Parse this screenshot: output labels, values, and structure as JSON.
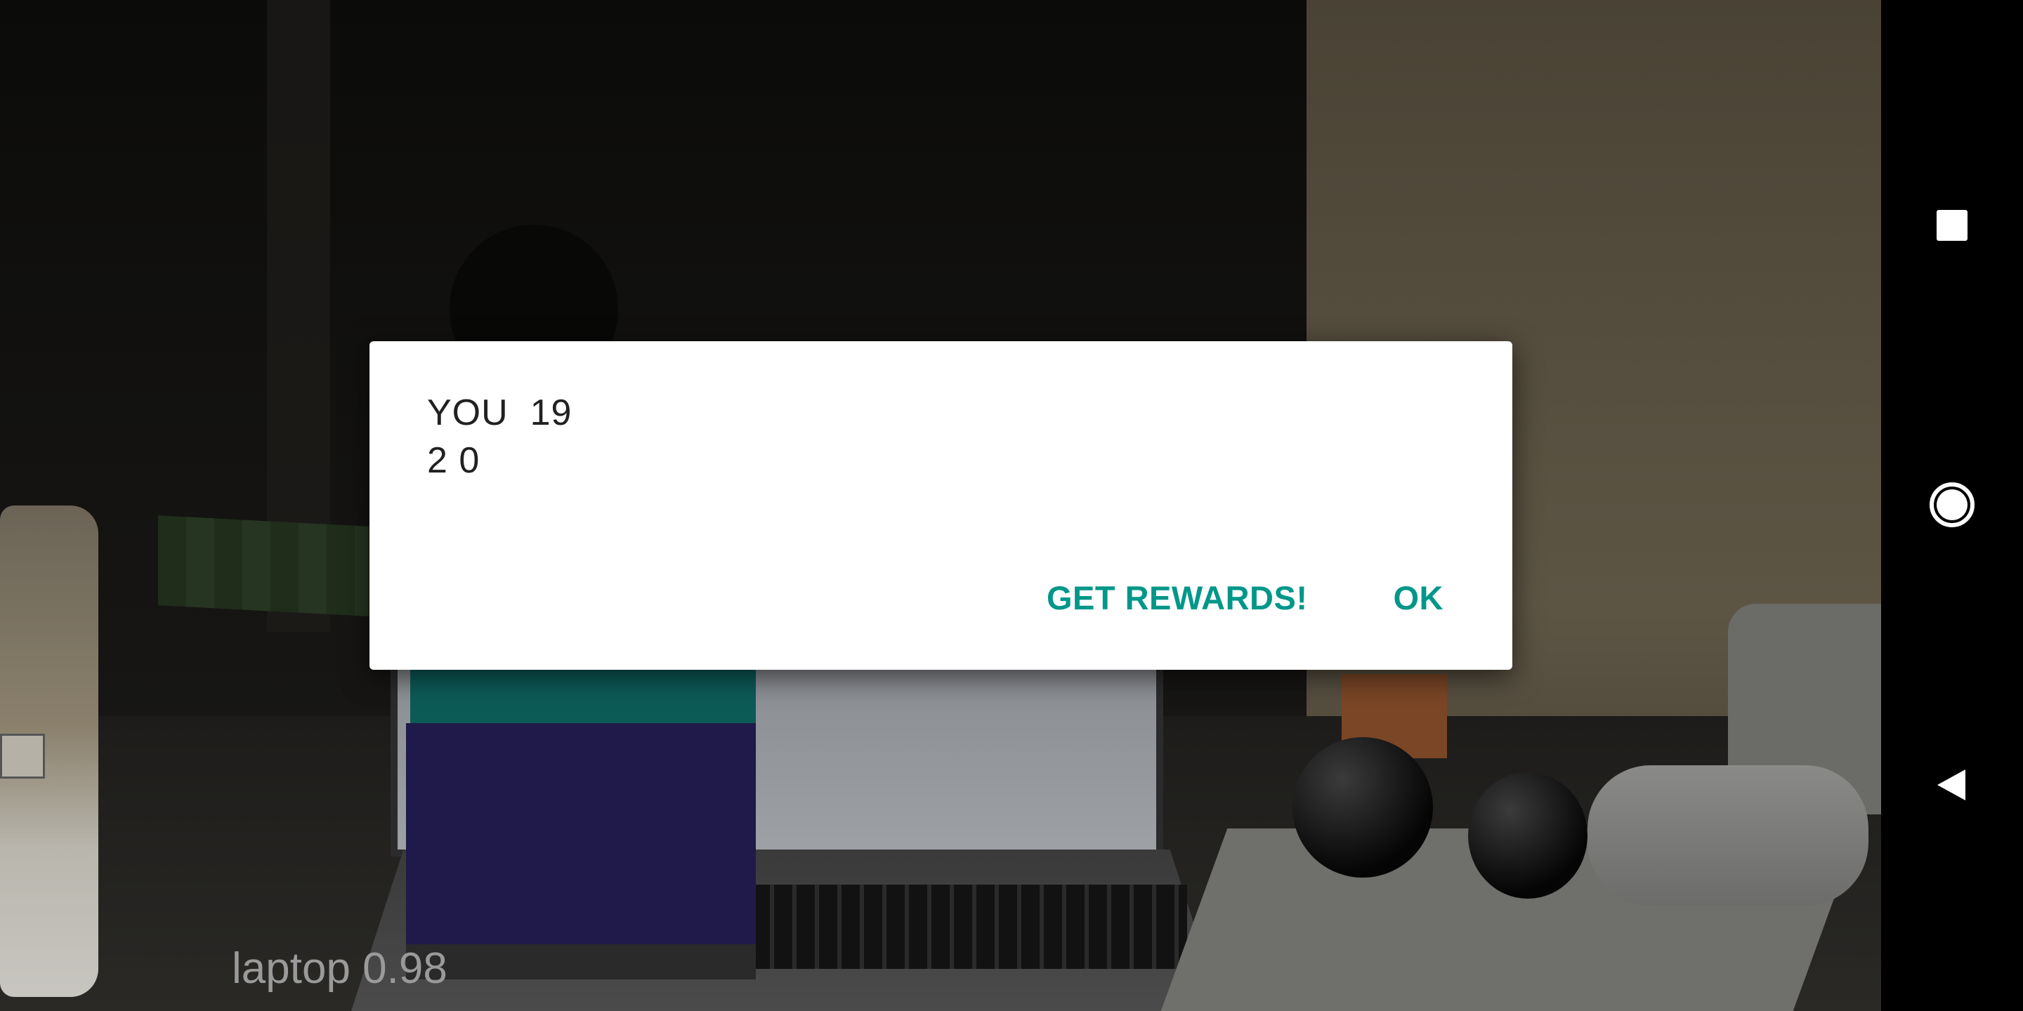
{
  "camera": {
    "detection_label": "laptop 0.98"
  },
  "dialog": {
    "message": "YOU  19\n2 0",
    "buttons": {
      "get_rewards": "GET REWARDS!",
      "ok": "OK"
    },
    "colors": {
      "accent": "#00978a",
      "text": "#212121",
      "background": "#ffffff"
    }
  },
  "navigation_bar": {
    "icons": [
      "recents-icon",
      "home-icon",
      "back-icon"
    ]
  }
}
